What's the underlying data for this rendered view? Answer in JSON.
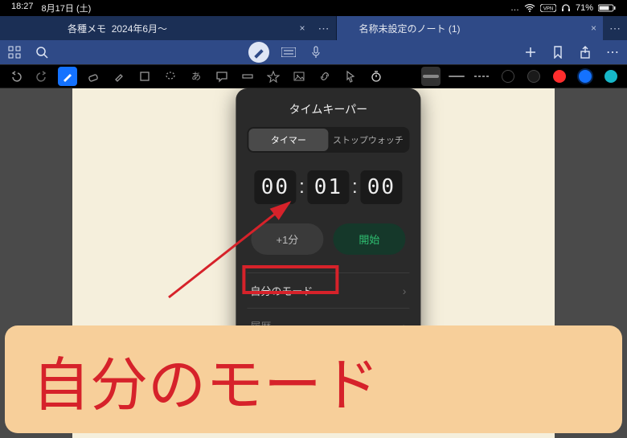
{
  "status": {
    "time": "18:27",
    "date": "8月17日 (土)",
    "battery_pct": "71%"
  },
  "tabs": {
    "left": {
      "title": "各種メモ",
      "subtitle": "2024年6月〜"
    },
    "right": {
      "title": "名称未設定のノート (1)"
    }
  },
  "popover": {
    "title": "タイムキーパー",
    "seg_timer": "タイマー",
    "seg_stopwatch": "ストップウォッチ",
    "hh": "00",
    "mm": "01",
    "ss": "00",
    "btn_plus1": "+1分",
    "btn_start": "開始",
    "row_mymode": "自分のモード",
    "row_history": "履歴"
  },
  "tool_colors": {
    "black": "#000000",
    "black2": "#1a1a1a",
    "red": "#ff2d2d",
    "blue": "#1472ff",
    "cyan": "#16b7c9"
  },
  "annotation": {
    "label": "自分のモード"
  }
}
